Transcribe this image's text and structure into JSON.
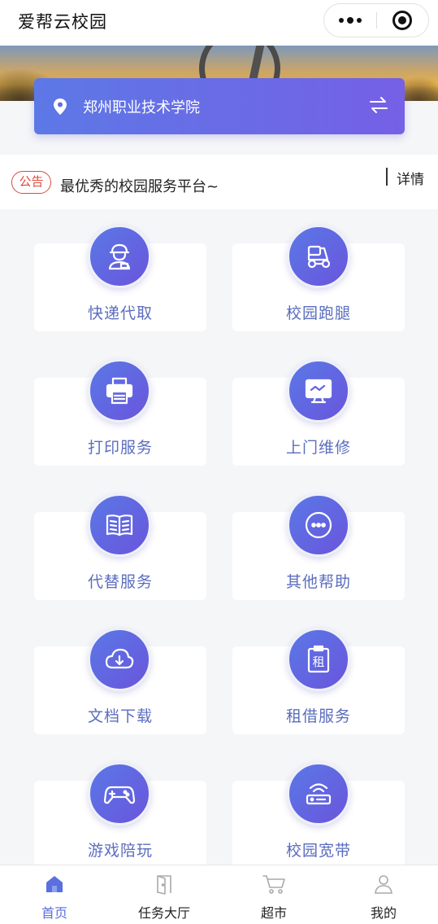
{
  "app": {
    "title": "爱帮云校园"
  },
  "campus": {
    "name": "郑州职业技术学院"
  },
  "notice": {
    "tag": "公告",
    "text": "最优秀的校园服务平台~",
    "detail_label": "详情"
  },
  "services": [
    {
      "label": "快递代取",
      "icon": "courier-icon"
    },
    {
      "label": "校园跑腿",
      "icon": "scooter-icon"
    },
    {
      "label": "打印服务",
      "icon": "printer-icon"
    },
    {
      "label": "上门维修",
      "icon": "monitor-icon"
    },
    {
      "label": "代替服务",
      "icon": "book-icon"
    },
    {
      "label": "其他帮助",
      "icon": "more-circle-icon"
    },
    {
      "label": "文档下载",
      "icon": "cloud-download-icon"
    },
    {
      "label": "租借服务",
      "icon": "rent-clipboard-icon"
    },
    {
      "label": "游戏陪玩",
      "icon": "gamepad-icon"
    },
    {
      "label": "校园宽带",
      "icon": "router-icon"
    }
  ],
  "rent_glyph": "租",
  "tabs": [
    {
      "label": "首页",
      "icon": "home-icon",
      "active": true
    },
    {
      "label": "任务大厅",
      "icon": "door-icon",
      "active": false
    },
    {
      "label": "超市",
      "icon": "cart-icon",
      "active": false
    },
    {
      "label": "我的",
      "icon": "user-icon",
      "active": false
    }
  ],
  "colors": {
    "accent": "#5a6fe0",
    "notice_red": "#e04a3c",
    "label_blue": "#5b6dbe"
  }
}
